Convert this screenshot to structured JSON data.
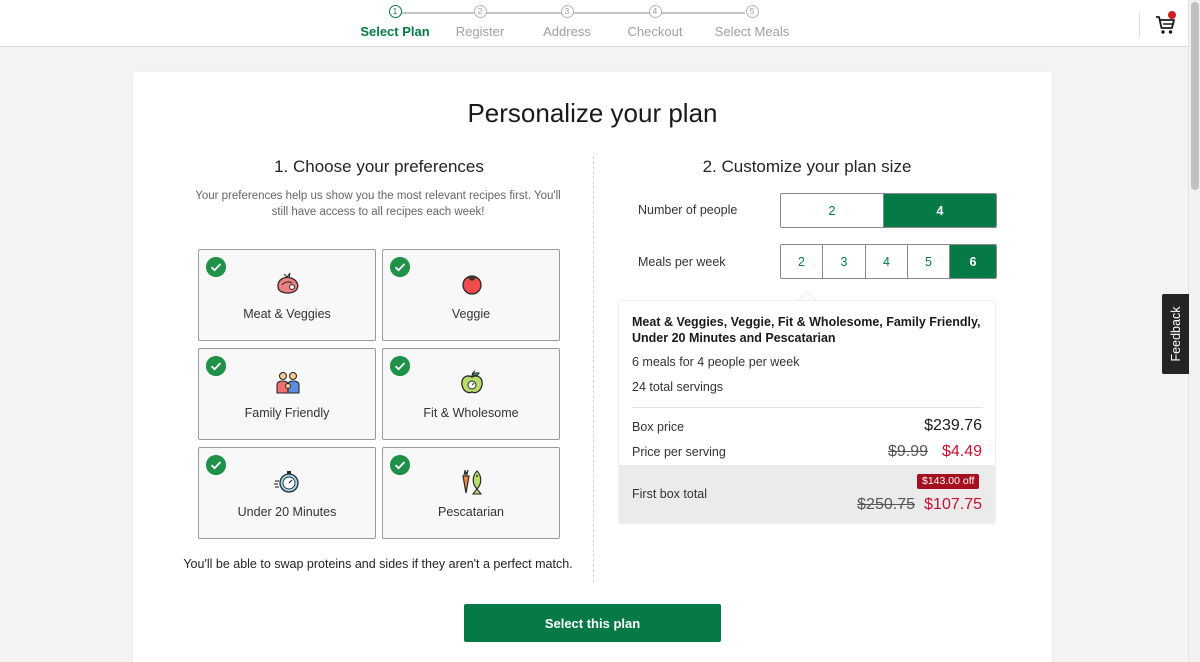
{
  "header": {
    "steps": [
      {
        "number": "1",
        "label": "Select Plan"
      },
      {
        "number": "2",
        "label": "Register"
      },
      {
        "number": "3",
        "label": "Address"
      },
      {
        "number": "4",
        "label": "Checkout"
      },
      {
        "number": "5",
        "label": "Select Meals"
      }
    ],
    "cart_icon": "cart-icon"
  },
  "page": {
    "title": "Personalize your plan",
    "preferences": {
      "title": "1. Choose your preferences",
      "help": "Your preferences help us show you the most relevant recipes first. You'll still have access to all recipes each week!",
      "items": [
        {
          "label": "Meat & Veggies",
          "icon": "steak-icon",
          "selected": true
        },
        {
          "label": "Veggie",
          "icon": "tomato-icon",
          "selected": true
        },
        {
          "label": "Family Friendly",
          "icon": "family-icon",
          "selected": true
        },
        {
          "label": "Fit & Wholesome",
          "icon": "apple-icon",
          "selected": true
        },
        {
          "label": "Under 20 Minutes",
          "icon": "stopwatch-icon",
          "selected": true
        },
        {
          "label": "Pescatarian",
          "icon": "fish-carrot-icon",
          "selected": true
        }
      ],
      "swap_note": "You'll be able to swap proteins and sides if they aren't a perfect match."
    },
    "plan_size": {
      "title": "2. Customize your plan size",
      "people_label": "Number of people",
      "people_options": [
        "2",
        "4"
      ],
      "people_selected": "4",
      "meals_label": "Meals per week",
      "meals_options": [
        "2",
        "3",
        "4",
        "5",
        "6"
      ],
      "meals_selected": "6"
    },
    "summary": {
      "preferences_text": "Meat & Veggies, Veggie, Fit & Wholesome, Family Friendly, Under 20 Minutes and Pescatarian",
      "meals_line": "6 meals for 4 people per week",
      "servings_line": "24 total servings",
      "box_price_label": "Box price",
      "box_price": "$239.76",
      "per_serving_label": "Price per serving",
      "per_serving_original": "$9.99",
      "per_serving_price": "$4.49",
      "first_box_label": "First box total",
      "discount_badge": "$143.00 off",
      "first_box_original": "$250.75",
      "first_box_price": "$107.75"
    },
    "cta_label": "Select this plan"
  },
  "feedback_label": "Feedback",
  "colors": {
    "brand_green": "#067a46",
    "check_green": "#1f9148",
    "price_red": "#c8102e",
    "badge_red": "#a50f1e"
  }
}
